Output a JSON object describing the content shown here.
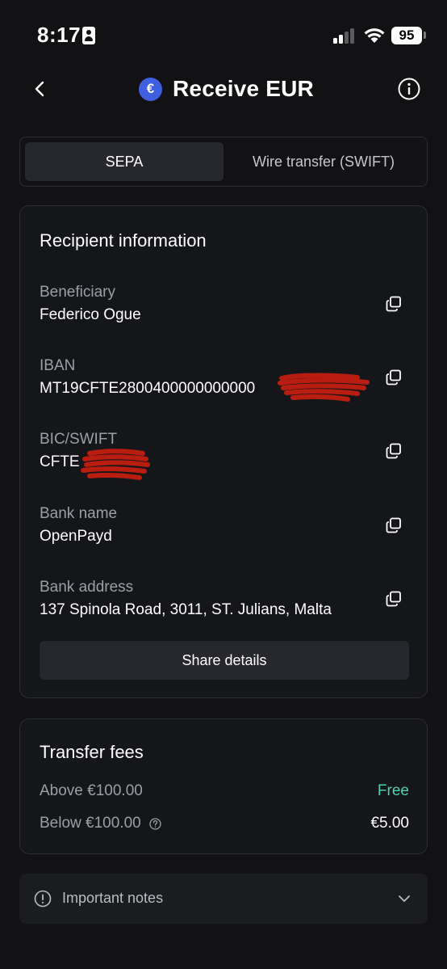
{
  "status_bar": {
    "time": "8:17",
    "battery": "95"
  },
  "header": {
    "title": "Receive EUR",
    "currency_symbol": "€"
  },
  "tabs": [
    {
      "label": "SEPA",
      "active": true
    },
    {
      "label": "Wire transfer (SWIFT)",
      "active": false
    }
  ],
  "recipient": {
    "title": "Recipient information",
    "fields": [
      {
        "label": "Beneficiary",
        "value": "Federico Ogue"
      },
      {
        "label": "IBAN",
        "value": "MT19CFTE2800400000000000"
      },
      {
        "label": "BIC/SWIFT",
        "value": "CFTE"
      },
      {
        "label": "Bank name",
        "value": "OpenPayd"
      },
      {
        "label": "Bank address",
        "value": "137 Spinola Road, 3011, ST. Julians, Malta"
      }
    ],
    "share_label": "Share details"
  },
  "fees": {
    "title": "Transfer fees",
    "rows": [
      {
        "label": "Above €100.00",
        "value": "Free"
      },
      {
        "label": "Below €100.00",
        "value": "€5.00"
      }
    ]
  },
  "notes": {
    "label": "Important notes"
  },
  "colors": {
    "background": "#121214",
    "accent_blue": "#3f5fe0",
    "free_green": "#4fd1b0",
    "redaction_red": "#b81d10"
  }
}
